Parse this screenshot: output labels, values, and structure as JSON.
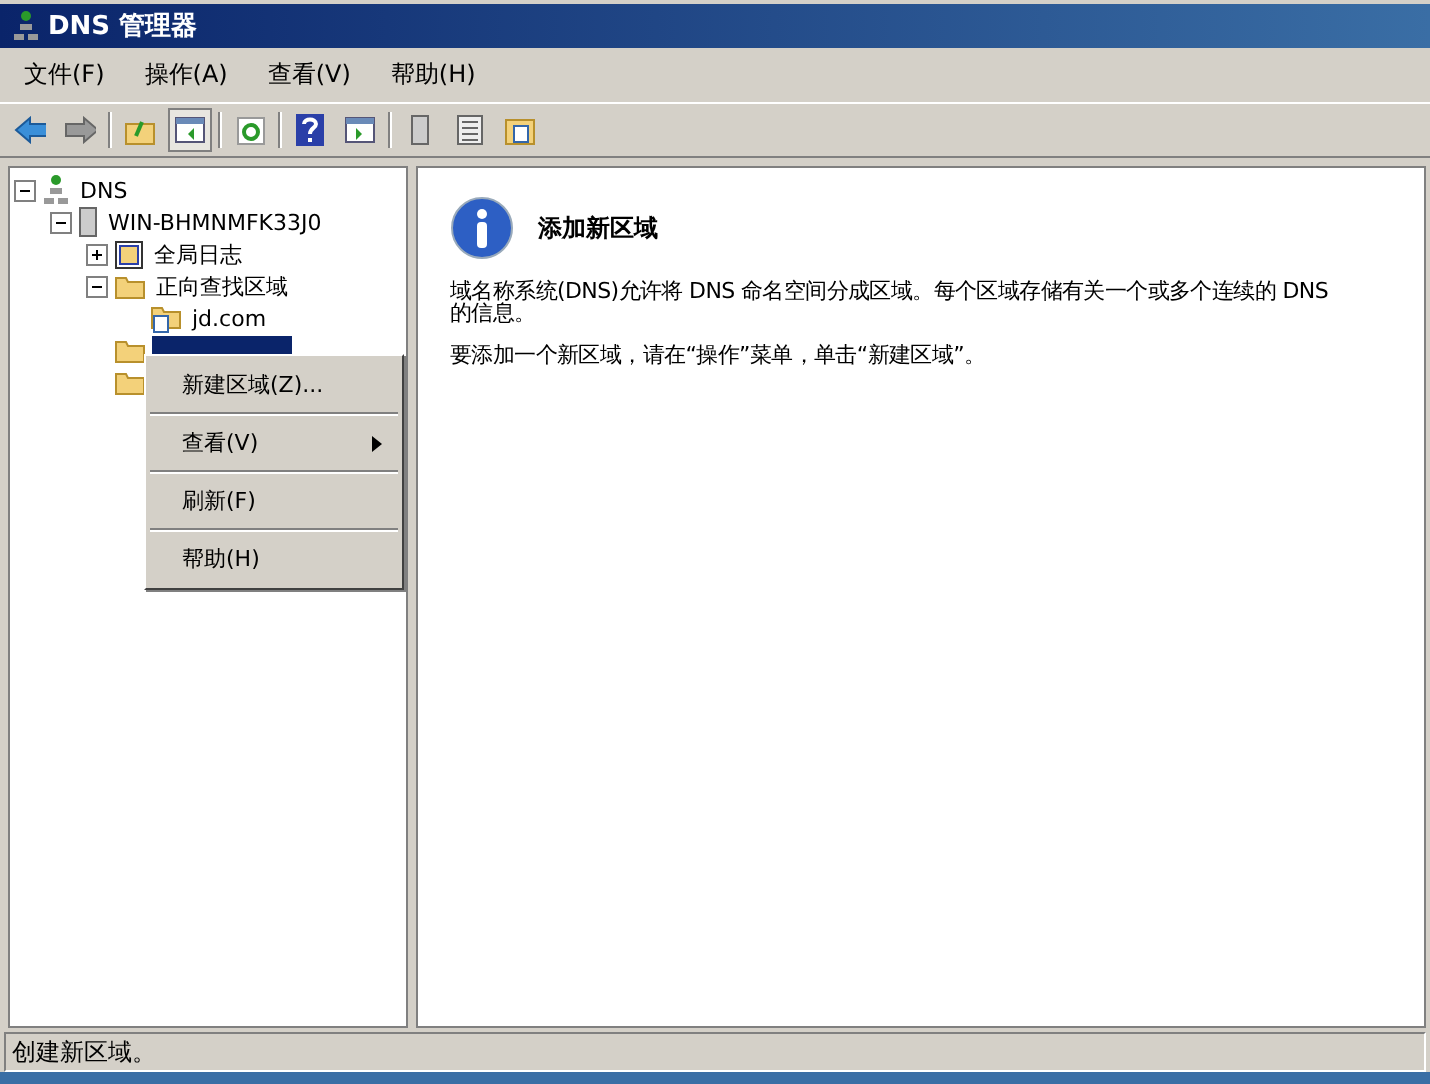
{
  "window": {
    "title": "DNS 管理器"
  },
  "menu_bar": [
    "文件(F)",
    "操作(A)",
    "查看(V)",
    "帮助(H)"
  ],
  "toolbar": [
    {
      "kind": "back"
    },
    {
      "kind": "forward"
    },
    {
      "kind": "sep"
    },
    {
      "kind": "up"
    },
    {
      "kind": "pane",
      "selected": true
    },
    {
      "kind": "sep"
    },
    {
      "kind": "refresh"
    },
    {
      "kind": "sep"
    },
    {
      "kind": "help"
    },
    {
      "kind": "pane2"
    },
    {
      "kind": "sep"
    },
    {
      "kind": "server"
    },
    {
      "kind": "list"
    },
    {
      "kind": "folderdoc"
    }
  ],
  "tree": [
    {
      "label": "DNS",
      "kind": "dns",
      "expanded": true,
      "children": [
        {
          "label": "WIN-BHMNMFK33J0",
          "kind": "server",
          "expanded": true,
          "children": [
            {
              "label": "全局日志",
              "kind": "log",
              "expanded": false
            },
            {
              "label": "正向查找区域",
              "kind": "folder",
              "expanded": true,
              "children": [
                {
                  "label": "jd.com",
                  "kind": "zone"
                }
              ]
            },
            {
              "kind": "folder",
              "selected": true
            },
            {
              "kind": "folder"
            }
          ]
        }
      ]
    }
  ],
  "context_menu": [
    {
      "label": "新建区域(Z)...",
      "submenu": false
    },
    {
      "label": "查看(V)",
      "submenu": true
    },
    {
      "label": "刷新(F)",
      "submenu": false
    },
    {
      "label": "帮助(H)",
      "submenu": false
    }
  ],
  "details": {
    "heading": "添加新区域",
    "paragraphs": [
      [
        "域名称系统(DNS)允许将 DNS 命名空间分成区域。每个区域存储有关一个或多个连续的 DNS",
        "的信息。"
      ],
      [
        "要添加一个新区域，请在“操作”菜单，单击“新建区域”。"
      ]
    ]
  },
  "status_bar": "创建新区域。"
}
